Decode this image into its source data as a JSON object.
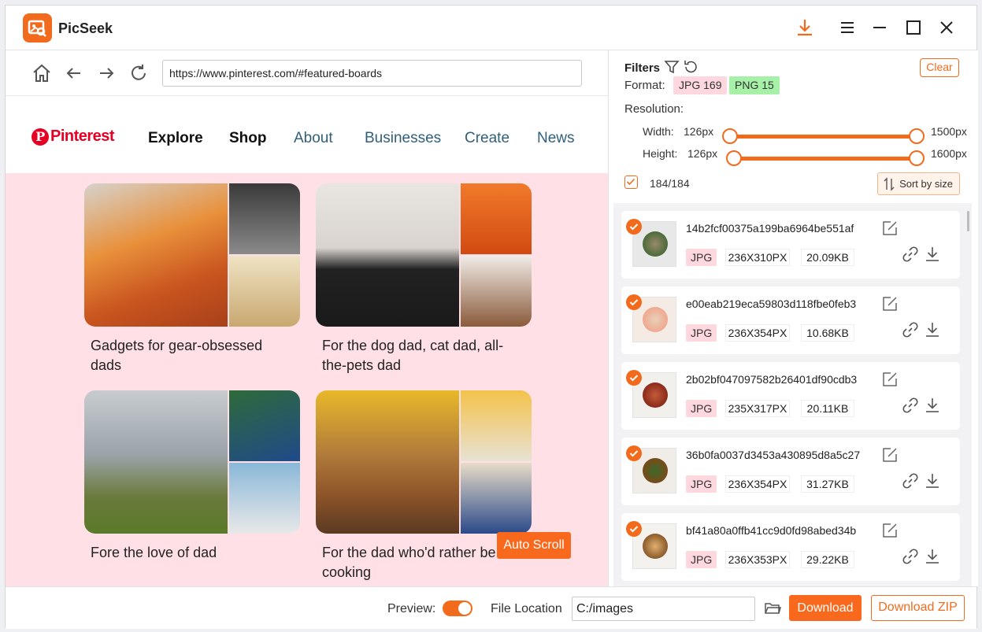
{
  "app": {
    "title": "PicSeek"
  },
  "browser": {
    "url": "https://www.pinterest.com/#featured-boards",
    "site_logo": "Pinterest",
    "nav": [
      "Explore",
      "Shop",
      "About",
      "Businesses",
      "Create",
      "News"
    ],
    "boards": [
      {
        "title": "Gadgets for gear-obsessed dads"
      },
      {
        "title": "For the dog dad, cat dad, all-the-pets dad"
      },
      {
        "title": "Fore the love of dad"
      },
      {
        "title": "For the dad who'd rather be cooking"
      }
    ],
    "auto_scroll_label": "Auto Scroll"
  },
  "filters": {
    "title": "Filters",
    "clear_label": "Clear",
    "format_label": "Format:",
    "formats": [
      {
        "label": "JPG 169",
        "color": "#ffd7de"
      },
      {
        "label": "PNG 15",
        "color": "#a6f0a8"
      }
    ],
    "resolution_label": "Resolution:",
    "width": {
      "label": "Width:",
      "min": "126px",
      "max": "1500px",
      "range": [
        0,
        1
      ]
    },
    "height": {
      "label": "Height:",
      "min": "126px",
      "max": "1600px",
      "range": [
        0,
        1
      ]
    },
    "selected_count": "184/184",
    "sort_label": "Sort by size"
  },
  "images": [
    {
      "name": "14b2fcf00375a199ba6964be551af",
      "format": "JPG",
      "dims": "236X310PX",
      "size": "20.09KB",
      "checked": true
    },
    {
      "name": "e00eab219eca59803d118fbe0feb3",
      "format": "JPG",
      "dims": "236X354PX",
      "size": "10.68KB",
      "checked": true
    },
    {
      "name": "2b02bf047097582b26401df90cdb3",
      "format": "JPG",
      "dims": "235X317PX",
      "size": "20.11KB",
      "checked": true
    },
    {
      "name": "36b0fa0037d3453a430895d8a5c27",
      "format": "JPG",
      "dims": "236X354PX",
      "size": "31.27KB",
      "checked": true
    },
    {
      "name": "bf41a80a0ffb41cc9d0fd98abed34b",
      "format": "JPG",
      "dims": "236X353PX",
      "size": "29.22KB",
      "checked": true
    }
  ],
  "bottom": {
    "preview_label": "Preview:",
    "preview_on": true,
    "file_location_label": "File Location",
    "file_location_value": "C:/images",
    "download_label": "Download",
    "download_zip_label": "Download ZIP"
  },
  "colors": {
    "accent": "#f26b1d",
    "pin_bg": "#ffe0e6",
    "pinterest_red": "#e60023"
  }
}
